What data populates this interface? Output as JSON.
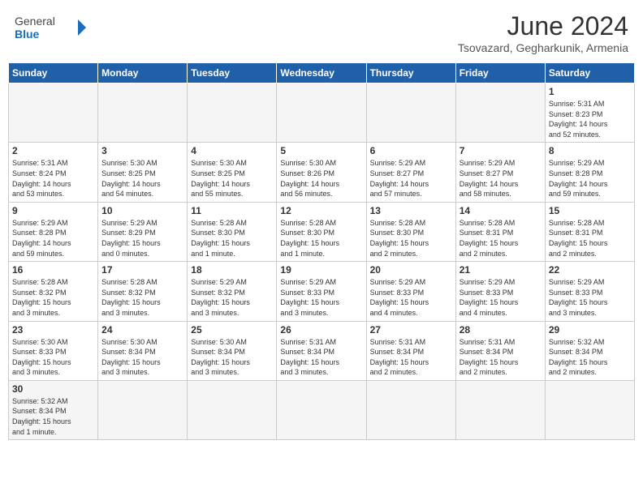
{
  "header": {
    "logo_general": "General",
    "logo_blue": "Blue",
    "title": "June 2024",
    "subtitle": "Tsovazard, Gegharkunik, Armenia"
  },
  "weekdays": [
    "Sunday",
    "Monday",
    "Tuesday",
    "Wednesday",
    "Thursday",
    "Friday",
    "Saturday"
  ],
  "weeks": [
    [
      {
        "day": "",
        "info": ""
      },
      {
        "day": "",
        "info": ""
      },
      {
        "day": "",
        "info": ""
      },
      {
        "day": "",
        "info": ""
      },
      {
        "day": "",
        "info": ""
      },
      {
        "day": "",
        "info": ""
      },
      {
        "day": "1",
        "info": "Sunrise: 5:31 AM\nSunset: 8:23 PM\nDaylight: 14 hours\nand 52 minutes."
      }
    ],
    [
      {
        "day": "2",
        "info": "Sunrise: 5:31 AM\nSunset: 8:24 PM\nDaylight: 14 hours\nand 53 minutes."
      },
      {
        "day": "3",
        "info": "Sunrise: 5:30 AM\nSunset: 8:25 PM\nDaylight: 14 hours\nand 54 minutes."
      },
      {
        "day": "4",
        "info": "Sunrise: 5:30 AM\nSunset: 8:25 PM\nDaylight: 14 hours\nand 55 minutes."
      },
      {
        "day": "5",
        "info": "Sunrise: 5:30 AM\nSunset: 8:26 PM\nDaylight: 14 hours\nand 56 minutes."
      },
      {
        "day": "6",
        "info": "Sunrise: 5:29 AM\nSunset: 8:27 PM\nDaylight: 14 hours\nand 57 minutes."
      },
      {
        "day": "7",
        "info": "Sunrise: 5:29 AM\nSunset: 8:27 PM\nDaylight: 14 hours\nand 58 minutes."
      },
      {
        "day": "8",
        "info": "Sunrise: 5:29 AM\nSunset: 8:28 PM\nDaylight: 14 hours\nand 59 minutes."
      }
    ],
    [
      {
        "day": "9",
        "info": "Sunrise: 5:29 AM\nSunset: 8:28 PM\nDaylight: 14 hours\nand 59 minutes."
      },
      {
        "day": "10",
        "info": "Sunrise: 5:29 AM\nSunset: 8:29 PM\nDaylight: 15 hours\nand 0 minutes."
      },
      {
        "day": "11",
        "info": "Sunrise: 5:28 AM\nSunset: 8:30 PM\nDaylight: 15 hours\nand 1 minute."
      },
      {
        "day": "12",
        "info": "Sunrise: 5:28 AM\nSunset: 8:30 PM\nDaylight: 15 hours\nand 1 minute."
      },
      {
        "day": "13",
        "info": "Sunrise: 5:28 AM\nSunset: 8:30 PM\nDaylight: 15 hours\nand 2 minutes."
      },
      {
        "day": "14",
        "info": "Sunrise: 5:28 AM\nSunset: 8:31 PM\nDaylight: 15 hours\nand 2 minutes."
      },
      {
        "day": "15",
        "info": "Sunrise: 5:28 AM\nSunset: 8:31 PM\nDaylight: 15 hours\nand 2 minutes."
      }
    ],
    [
      {
        "day": "16",
        "info": "Sunrise: 5:28 AM\nSunset: 8:32 PM\nDaylight: 15 hours\nand 3 minutes."
      },
      {
        "day": "17",
        "info": "Sunrise: 5:28 AM\nSunset: 8:32 PM\nDaylight: 15 hours\nand 3 minutes."
      },
      {
        "day": "18",
        "info": "Sunrise: 5:29 AM\nSunset: 8:32 PM\nDaylight: 15 hours\nand 3 minutes."
      },
      {
        "day": "19",
        "info": "Sunrise: 5:29 AM\nSunset: 8:33 PM\nDaylight: 15 hours\nand 3 minutes."
      },
      {
        "day": "20",
        "info": "Sunrise: 5:29 AM\nSunset: 8:33 PM\nDaylight: 15 hours\nand 4 minutes."
      },
      {
        "day": "21",
        "info": "Sunrise: 5:29 AM\nSunset: 8:33 PM\nDaylight: 15 hours\nand 4 minutes."
      },
      {
        "day": "22",
        "info": "Sunrise: 5:29 AM\nSunset: 8:33 PM\nDaylight: 15 hours\nand 3 minutes."
      }
    ],
    [
      {
        "day": "23",
        "info": "Sunrise: 5:30 AM\nSunset: 8:33 PM\nDaylight: 15 hours\nand 3 minutes."
      },
      {
        "day": "24",
        "info": "Sunrise: 5:30 AM\nSunset: 8:34 PM\nDaylight: 15 hours\nand 3 minutes."
      },
      {
        "day": "25",
        "info": "Sunrise: 5:30 AM\nSunset: 8:34 PM\nDaylight: 15 hours\nand 3 minutes."
      },
      {
        "day": "26",
        "info": "Sunrise: 5:31 AM\nSunset: 8:34 PM\nDaylight: 15 hours\nand 3 minutes."
      },
      {
        "day": "27",
        "info": "Sunrise: 5:31 AM\nSunset: 8:34 PM\nDaylight: 15 hours\nand 2 minutes."
      },
      {
        "day": "28",
        "info": "Sunrise: 5:31 AM\nSunset: 8:34 PM\nDaylight: 15 hours\nand 2 minutes."
      },
      {
        "day": "29",
        "info": "Sunrise: 5:32 AM\nSunset: 8:34 PM\nDaylight: 15 hours\nand 2 minutes."
      }
    ],
    [
      {
        "day": "30",
        "info": "Sunrise: 5:32 AM\nSunset: 8:34 PM\nDaylight: 15 hours\nand 1 minute."
      },
      {
        "day": "",
        "info": ""
      },
      {
        "day": "",
        "info": ""
      },
      {
        "day": "",
        "info": ""
      },
      {
        "day": "",
        "info": ""
      },
      {
        "day": "",
        "info": ""
      },
      {
        "day": "",
        "info": ""
      }
    ]
  ]
}
